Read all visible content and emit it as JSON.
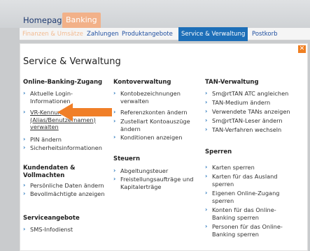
{
  "topnav": {
    "home": "Homepage",
    "banking": "Banking"
  },
  "subnav": [
    {
      "label": "Finanzen & Umsätze",
      "state": "dim"
    },
    {
      "label": "Zahlungen",
      "state": "normal"
    },
    {
      "label": "Produktangebote",
      "state": "normal"
    },
    {
      "label": "Service & Verwaltung",
      "state": "active"
    },
    {
      "label": "Postkorb",
      "state": "normal"
    }
  ],
  "panel": {
    "title": "Service & Verwaltung",
    "close_icon": "close-icon",
    "sections": {
      "online_banking": {
        "title": "Online-Banking-Zugang",
        "items": [
          "Aktuelle Login-Informationen",
          "VR-Kennung (Alias/Benutzernamen) verwalten",
          "PIN ändern",
          "Sicherheitsinformationen"
        ]
      },
      "kundendaten": {
        "title": "Kundendaten & Vollmachten",
        "items": [
          "Persönliche Daten ändern",
          "Bevollmächtigte anzeigen"
        ]
      },
      "service": {
        "title": "Serviceangebote",
        "items": [
          "SMS-Infodienst"
        ]
      },
      "kontoverwaltung": {
        "title": "Kontoverwaltung",
        "items": [
          "Kontobezeichnungen verwalten",
          "Referenzkonten ändern",
          "Zustellart Kontoauszüge ändern",
          "Konditionen anzeigen"
        ]
      },
      "steuern": {
        "title": "Steuern",
        "items": [
          "Abgeltungsteuer",
          "Freistellungsaufträge und Kapitalerträge"
        ]
      },
      "tan": {
        "title": "TAN-Verwaltung",
        "items": [
          "Sm@rtTAN ATC angleichen",
          "TAN-Medium ändern",
          "Verwendete TANs anzeigen",
          "Sm@rtTAN-Leser ändern",
          "TAN-Verfahren wechseln"
        ]
      },
      "sperren": {
        "title": "Sperren",
        "items": [
          "Karten sperren",
          "Karten für das Ausland sperren",
          "Eigenen Online-Zugang sperren",
          "Konten für das Online-Banking sperren",
          "Personen für das Online-Banking sperren"
        ]
      }
    }
  },
  "colors": {
    "accent_blue": "#1d6fb8",
    "accent_orange": "#ef7f22",
    "tab_banking": "#f2b189"
  }
}
